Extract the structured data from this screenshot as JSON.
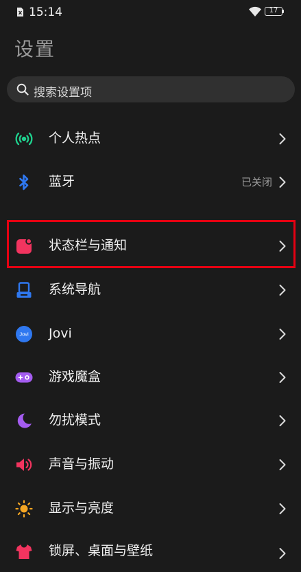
{
  "status_bar": {
    "time": "15:14",
    "battery_level": "17",
    "icons": [
      "sim-off-icon",
      "wifi-icon",
      "battery-icon"
    ]
  },
  "page": {
    "title": "设置"
  },
  "search": {
    "placeholder": "搜索设置项"
  },
  "settings": {
    "items": [
      {
        "label": "个人热点",
        "icon": "hotspot-icon",
        "color": "#1fd28f"
      },
      {
        "label": "蓝牙",
        "value": "已关闭",
        "icon": "bluetooth-icon",
        "color": "#2f78f0"
      },
      {
        "label": "状态栏与通知",
        "icon": "notification-icon",
        "color": "#f2345f"
      },
      {
        "label": "系统导航",
        "icon": "navigation-icon",
        "color": "#2f78f0"
      },
      {
        "label": "Jovi",
        "icon": "jovi-icon",
        "color": "#2f78f0",
        "icon_text": "Jovi"
      },
      {
        "label": "游戏魔盒",
        "icon": "game-box-icon",
        "color": "#a45cf0"
      },
      {
        "label": "勿扰模式",
        "icon": "moon-icon",
        "color": "#a45cf0"
      },
      {
        "label": "声音与振动",
        "icon": "sound-icon",
        "color": "#f2345f"
      },
      {
        "label": "显示与亮度",
        "icon": "sun-icon",
        "color": "#f5a623"
      },
      {
        "label": "锁屏、桌面与壁纸",
        "icon": "wallpaper-icon",
        "color": "#f2345f"
      }
    ]
  },
  "highlight_color": "#e60012"
}
